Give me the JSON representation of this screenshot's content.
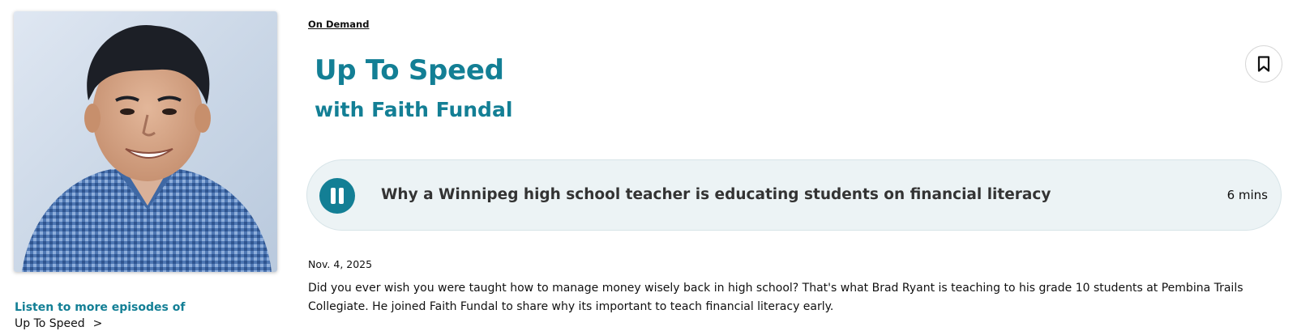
{
  "breadcrumb": "On Demand",
  "show": {
    "title": "Up To Speed",
    "subtitle": "with Faith Fundal"
  },
  "icons": {
    "bookmark": "bookmark-icon",
    "pause": "pause-icon",
    "chevron": "chevron-right-icon"
  },
  "player": {
    "episode_title": "Why a Winnipeg high school teacher is educating students on financial literacy",
    "duration": "6 mins",
    "state": "playing"
  },
  "episode": {
    "date": "Nov. 4, 2025",
    "description": "Did you ever wish you were taught how to manage money wisely back in high school? That's what Brad Ryant is teaching to his grade 10 students at Pembina Trails Collegiate. He joined Faith Fundal to share why its important to teach financial literacy early."
  },
  "more_episodes": {
    "label": "Listen to more episodes of",
    "show_name": "Up To Speed",
    "chevron": ">"
  },
  "colors": {
    "accent": "#137f95",
    "player_bg": "#ecf3f5",
    "text": "#111111"
  }
}
